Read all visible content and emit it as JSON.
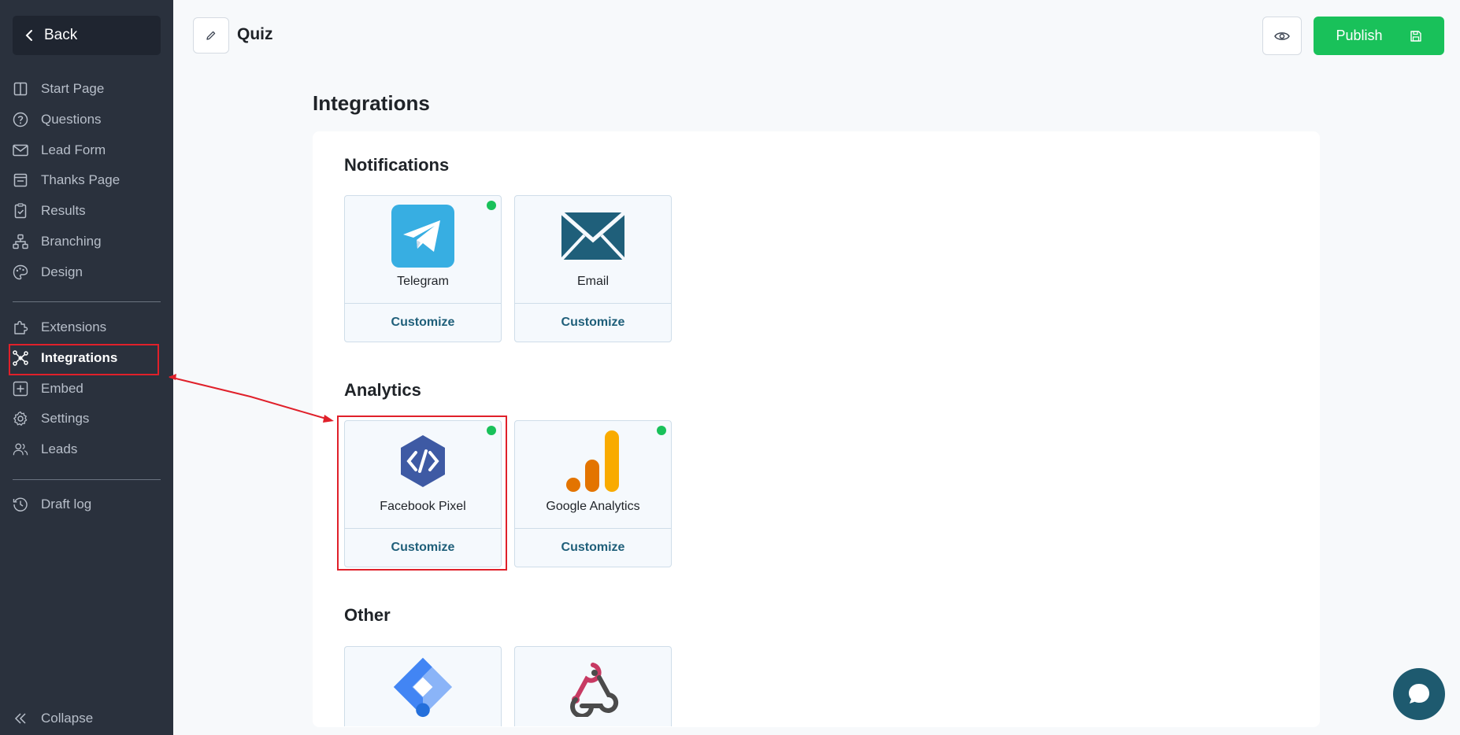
{
  "sidebar": {
    "back_label": "Back",
    "items": [
      {
        "label": "Start Page",
        "icon": "layout-icon"
      },
      {
        "label": "Questions",
        "icon": "question-circle-icon"
      },
      {
        "label": "Lead Form",
        "icon": "envelope-icon"
      },
      {
        "label": "Thanks Page",
        "icon": "thanks-page-icon"
      },
      {
        "label": "Results",
        "icon": "clipboard-check-icon"
      },
      {
        "label": "Branching",
        "icon": "branching-icon"
      },
      {
        "label": "Design",
        "icon": "palette-icon"
      }
    ],
    "items2": [
      {
        "label": "Extensions",
        "icon": "puzzle-icon"
      },
      {
        "label": "Integrations",
        "icon": "integrations-icon",
        "active": true
      },
      {
        "label": "Embed",
        "icon": "embed-icon"
      },
      {
        "label": "Settings",
        "icon": "gear-icon"
      },
      {
        "label": "Leads",
        "icon": "users-icon"
      }
    ],
    "items3": [
      {
        "label": "Draft log",
        "icon": "history-icon"
      }
    ],
    "collapse_label": "Collapse"
  },
  "header": {
    "title": "Quiz",
    "publish_label": "Publish"
  },
  "page": {
    "title": "Integrations"
  },
  "sections": {
    "notifications": {
      "title": "Notifications",
      "cards": [
        {
          "name": "Telegram",
          "action": "Customize",
          "active": true
        },
        {
          "name": "Email",
          "action": "Customize",
          "active": false
        }
      ]
    },
    "analytics": {
      "title": "Analytics",
      "cards": [
        {
          "name": "Facebook Pixel",
          "action": "Customize",
          "active": true
        },
        {
          "name": "Google Analytics",
          "action": "Customize",
          "active": true
        }
      ]
    },
    "other": {
      "title": "Other"
    }
  },
  "colors": {
    "sidebar_bg": "#2a313d",
    "publish_green": "#19c15a",
    "annotation_red": "#e0202a",
    "customize_text": "#1f5f7a"
  }
}
